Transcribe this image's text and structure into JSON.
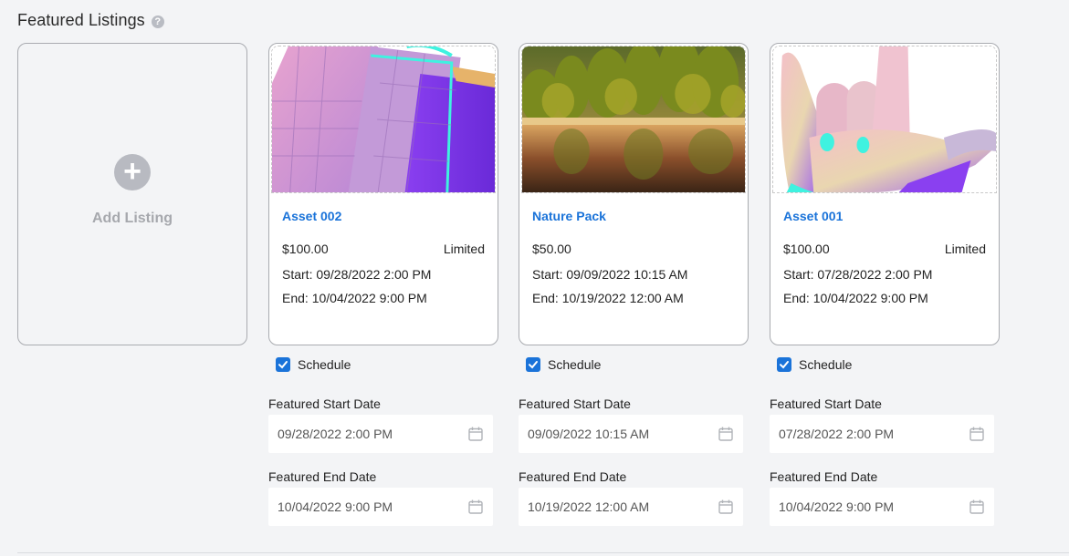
{
  "section": {
    "title": "Featured Listings",
    "help_icon": "help-circle-icon"
  },
  "add_card": {
    "label": "Add Listing",
    "icon": "plus-circle-icon"
  },
  "listings": [
    {
      "title": "Asset 002",
      "price": "$100.00",
      "tag": "Limited",
      "start": "Start: 09/28/2022 2:00 PM",
      "end": "End: 10/04/2022 9:00 PM",
      "schedule_label": "Schedule",
      "schedule_checked": true,
      "start_label": "Featured Start Date",
      "start_value": "09/28/2022 2:00 PM",
      "end_label": "Featured End Date",
      "end_value": "10/04/2022 9:00 PM",
      "image": "3d-cube-render"
    },
    {
      "title": "Nature Pack",
      "price": "$50.00",
      "tag": "",
      "start": "Start: 09/09/2022 10:15 AM",
      "end": "End: 10/19/2022 12:00 AM",
      "schedule_label": "Schedule",
      "schedule_checked": true,
      "start_label": "Featured Start Date",
      "start_value": "09/09/2022 10:15 AM",
      "end_label": "Featured End Date",
      "end_value": "10/19/2022 12:00 AM",
      "image": "lake-forest-photo"
    },
    {
      "title": "Asset 001",
      "price": "$100.00",
      "tag": "Limited",
      "start": "Start: 07/28/2022 2:00 PM",
      "end": "End: 10/04/2022 9:00 PM",
      "schedule_label": "Schedule",
      "schedule_checked": true,
      "start_label": "Featured Start Date",
      "start_value": "07/28/2022 2:00 PM",
      "end_label": "Featured End Date",
      "end_value": "10/04/2022 9:00 PM",
      "image": "3d-hand-render"
    }
  ],
  "colors": {
    "accent": "#1a73d9",
    "card_border": "#a9abb0",
    "background": "#f3f4f6"
  }
}
